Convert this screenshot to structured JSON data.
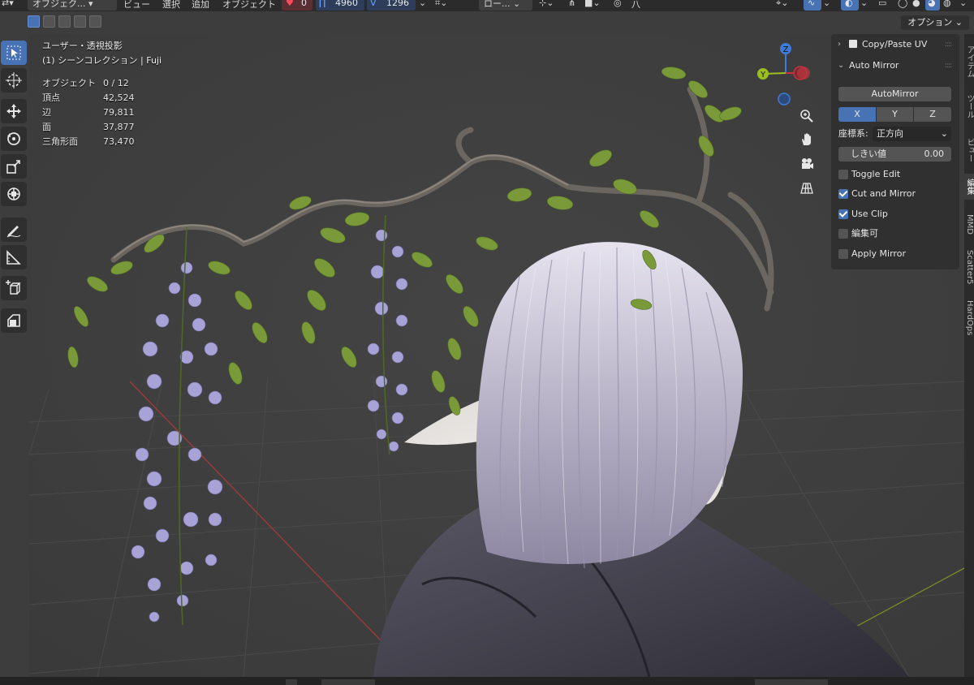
{
  "header": {
    "mode_label": "オブジェク...",
    "menu": [
      "ビュー",
      "選択",
      "追加",
      "オブジェクト"
    ],
    "counter_a": "0",
    "counter_b": "4960",
    "counter_c": "1296",
    "pivot_label": "ロー...",
    "snap_label": "八"
  },
  "options_label": "オプション",
  "viewport": {
    "view_name": "ユーザー・透視投影",
    "collection": "(1) シーンコレクション | Fuji"
  },
  "stats": [
    {
      "label": "オブジェクト",
      "value": "0 / 12"
    },
    {
      "label": "頂点",
      "value": "42,524"
    },
    {
      "label": "辺",
      "value": "79,811"
    },
    {
      "label": "面",
      "value": "37,877"
    },
    {
      "label": "三角形面",
      "value": "73,470"
    }
  ],
  "gizmo": {
    "z": "Z",
    "y": "Y"
  },
  "panel": {
    "copy_paste_title": "Copy/Paste UV",
    "auto_mirror_title": "Auto Mirror",
    "auto_mirror_button": "AutoMirror",
    "axes": [
      "X",
      "Y",
      "Z"
    ],
    "orientation_label": "座標系:",
    "orientation_value": "正方向",
    "threshold_label": "しきい値",
    "threshold_value": "0.00",
    "checks": [
      {
        "label": "Toggle Edit",
        "checked": false
      },
      {
        "label": "Cut and Mirror",
        "checked": true
      },
      {
        "label": "Use Clip",
        "checked": true
      },
      {
        "label": "編集可",
        "checked": false
      },
      {
        "label": "Apply Mirror",
        "checked": false
      }
    ]
  },
  "tabs": [
    "アイテム",
    "ツール",
    "ビュー",
    "編集",
    "MMD",
    "Scatter5",
    "HardOps"
  ],
  "colors": {
    "accent": "#4772b3",
    "panel": "#303030",
    "viewport": "#3d3d3d"
  }
}
